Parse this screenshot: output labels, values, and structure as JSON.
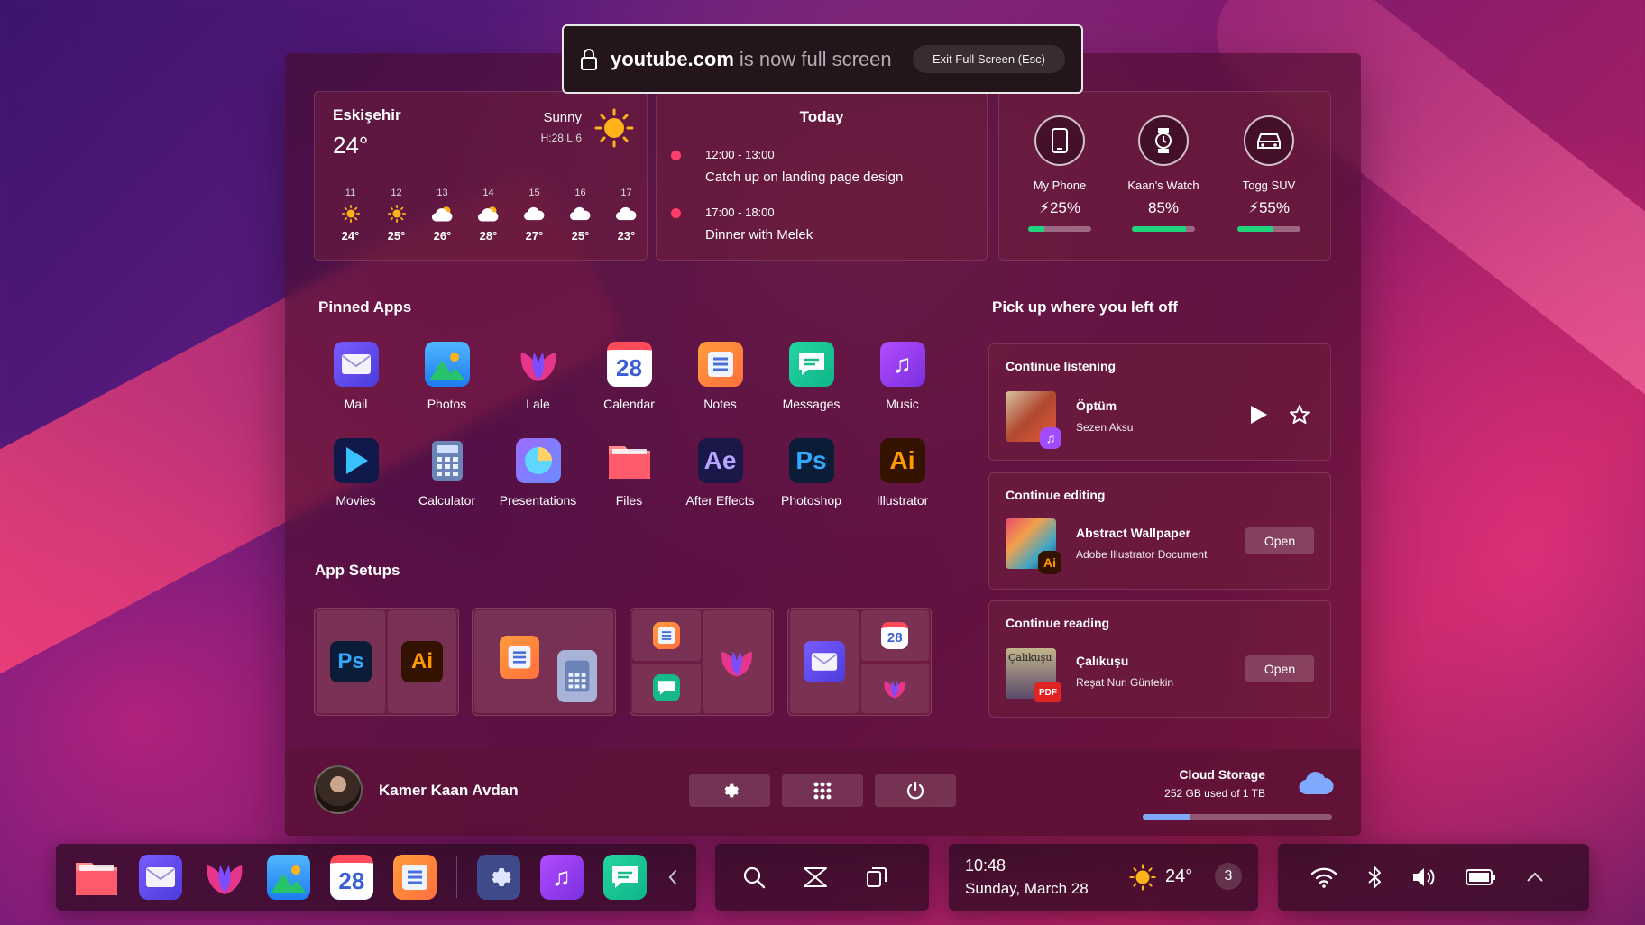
{
  "banner": {
    "domain": "youtube.com",
    "suffix": "is now full screen",
    "exit": "Exit Full Screen (Esc)"
  },
  "weather": {
    "city": "Eskişehir",
    "temp": "24°",
    "condition": "Sunny",
    "hilo": "H:28 L:6",
    "forecast": [
      {
        "day": "11",
        "temp": "24°",
        "icon": "sun-icon"
      },
      {
        "day": "12",
        "temp": "25°",
        "icon": "sun-icon"
      },
      {
        "day": "13",
        "temp": "26°",
        "icon": "partly-cloudy-icon"
      },
      {
        "day": "14",
        "temp": "28°",
        "icon": "partly-cloudy-icon"
      },
      {
        "day": "15",
        "temp": "27°",
        "icon": "cloud-icon"
      },
      {
        "day": "16",
        "temp": "25°",
        "icon": "cloud-icon"
      },
      {
        "day": "17",
        "temp": "23°",
        "icon": "cloud-icon"
      }
    ]
  },
  "calendar": {
    "title": "Today",
    "events": [
      {
        "time": "12:00 - 13:00",
        "name": "Catch up on landing page design"
      },
      {
        "time": "17:00 - 18:00",
        "name": "Dinner with Melek"
      }
    ]
  },
  "devices": [
    {
      "name": "My Phone",
      "battery": "25%",
      "level": 0.25,
      "charging": true,
      "icon": "phone-icon"
    },
    {
      "name": "Kaan's Watch",
      "battery": "85%",
      "level": 0.85,
      "charging": false,
      "icon": "watch-icon"
    },
    {
      "name": "Togg SUV",
      "battery": "55%",
      "level": 0.55,
      "charging": true,
      "icon": "car-icon"
    }
  ],
  "pinned": {
    "title": "Pinned Apps",
    "apps": [
      {
        "label": "Mail",
        "icon": "mail-icon"
      },
      {
        "label": "Photos",
        "icon": "photos-icon"
      },
      {
        "label": "Lale",
        "icon": "lale-icon"
      },
      {
        "label": "Calendar",
        "icon": "calendar-icon",
        "glyph": "28"
      },
      {
        "label": "Notes",
        "icon": "notes-icon"
      },
      {
        "label": "Messages",
        "icon": "messages-icon"
      },
      {
        "label": "Music",
        "icon": "music-icon"
      },
      {
        "label": "Movies",
        "icon": "movies-icon"
      },
      {
        "label": "Calculator",
        "icon": "calculator-icon"
      },
      {
        "label": "Presentations",
        "icon": "presentations-icon"
      },
      {
        "label": "Files",
        "icon": "files-icon"
      },
      {
        "label": "After Effects",
        "icon": "after-effects-icon",
        "glyph": "Ae"
      },
      {
        "label": "Photoshop",
        "icon": "photoshop-icon",
        "glyph": "Ps"
      },
      {
        "label": "Illustrator",
        "icon": "illustrator-icon",
        "glyph": "Ai"
      }
    ]
  },
  "setups": {
    "title": "App Setups",
    "ps": "Ps",
    "ai": "Ai",
    "cal": "28"
  },
  "resume": {
    "title": "Pick up where you left off",
    "listening": {
      "header": "Continue listening",
      "name": "Öptüm",
      "sub": "Sezen Aksu"
    },
    "editing": {
      "header": "Continue editing",
      "name": "Abstract Wallpaper",
      "sub": "Adobe Illustrator Document",
      "button": "Open",
      "badge": "Ai"
    },
    "reading": {
      "header": "Continue reading",
      "name": "Çalıkuşu",
      "sub": "Reşat Nuri Güntekin",
      "button": "Open",
      "badge": "PDF",
      "cover": "Çalıkuşu"
    }
  },
  "footer": {
    "user": "Kamer Kaan Avdan",
    "cloud_title": "Cloud Storage",
    "cloud_sub": "252 GB used of 1 TB",
    "cloud_level": 0.25
  },
  "taskbar": {
    "cal": "28",
    "time": "10:48",
    "date": "Sunday, March 28",
    "temp": "24°",
    "count": "3"
  },
  "colors": {
    "accent_green": "#1fd47c",
    "event_dot": "#ff3d6a",
    "cloud": "#7fa8ff"
  }
}
